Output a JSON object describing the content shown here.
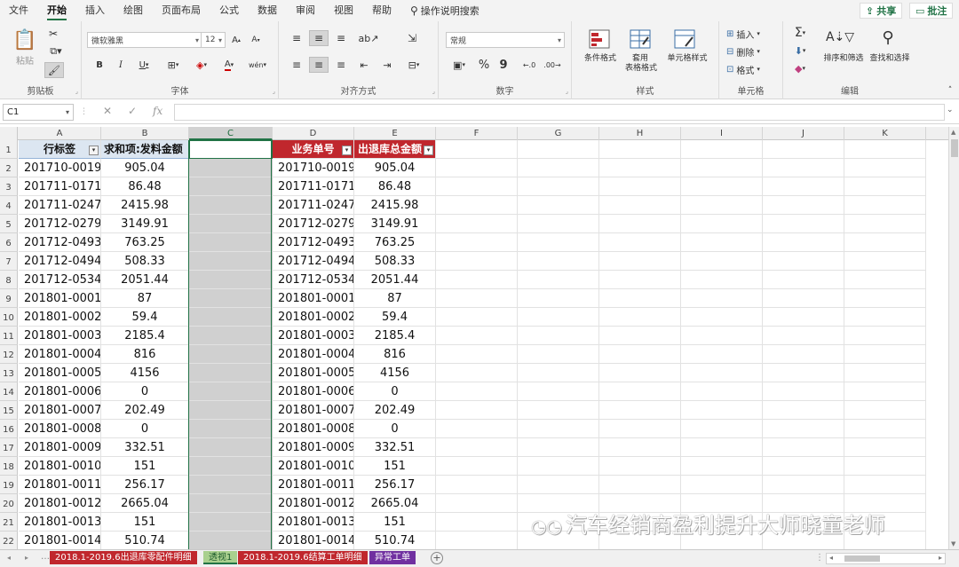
{
  "menu": {
    "items": [
      "文件",
      "开始",
      "插入",
      "绘图",
      "页面布局",
      "公式",
      "数据",
      "审阅",
      "视图",
      "帮助"
    ],
    "active_index": 1,
    "tell_me": "操作说明搜索",
    "share": "共享",
    "comments": "批注"
  },
  "ribbon": {
    "clipboard": {
      "label": "剪贴板",
      "paste": "粘贴"
    },
    "font": {
      "label": "字体",
      "name": "微软雅黑",
      "size": "12",
      "bold": "B",
      "italic": "I",
      "underline": "U",
      "grow": "A",
      "shrink": "A",
      "color": "A",
      "phonetic": "wén"
    },
    "alignment": {
      "label": "对齐方式"
    },
    "number": {
      "label": "数字",
      "format": "常规",
      "percent": "%",
      "comma": "9"
    },
    "styles": {
      "label": "样式",
      "conditional": "条件格式",
      "as_table_1": "套用",
      "as_table_2": "表格格式",
      "cell_styles": "单元格样式"
    },
    "cells": {
      "label": "单元格",
      "insert": "插入",
      "delete": "删除",
      "format": "格式"
    },
    "editing": {
      "label": "编辑",
      "sum": "Σ",
      "sort_filter": "排序和筛选",
      "find_select": "查找和选择"
    }
  },
  "formula_bar": {
    "name_box": "C1",
    "fx": "fx",
    "value": ""
  },
  "columns": [
    "A",
    "B",
    "C",
    "D",
    "E",
    "F",
    "G",
    "H",
    "I",
    "J",
    "K"
  ],
  "headers": {
    "a": "行标签",
    "b": "求和项:发料金额",
    "d": "业务单号",
    "e": "出退库总金额"
  },
  "rows": [
    {
      "n": "2",
      "a": "201710-0019",
      "b": "905.04",
      "d": "201710-0019",
      "e": "905.04"
    },
    {
      "n": "3",
      "a": "201711-0171",
      "b": "86.48",
      "d": "201711-0171",
      "e": "86.48"
    },
    {
      "n": "4",
      "a": "201711-0247",
      "b": "2415.98",
      "d": "201711-0247",
      "e": "2415.98"
    },
    {
      "n": "5",
      "a": "201712-0279",
      "b": "3149.91",
      "d": "201712-0279",
      "e": "3149.91"
    },
    {
      "n": "6",
      "a": "201712-0493",
      "b": "763.25",
      "d": "201712-0493",
      "e": "763.25"
    },
    {
      "n": "7",
      "a": "201712-0494",
      "b": "508.33",
      "d": "201712-0494",
      "e": "508.33"
    },
    {
      "n": "8",
      "a": "201712-0534",
      "b": "2051.44",
      "d": "201712-0534",
      "e": "2051.44"
    },
    {
      "n": "9",
      "a": "201801-0001",
      "b": "87",
      "d": "201801-0001",
      "e": "87"
    },
    {
      "n": "10",
      "a": "201801-0002",
      "b": "59.4",
      "d": "201801-0002",
      "e": "59.4"
    },
    {
      "n": "11",
      "a": "201801-0003",
      "b": "2185.4",
      "d": "201801-0003",
      "e": "2185.4"
    },
    {
      "n": "12",
      "a": "201801-0004",
      "b": "816",
      "d": "201801-0004",
      "e": "816"
    },
    {
      "n": "13",
      "a": "201801-0005",
      "b": "4156",
      "d": "201801-0005",
      "e": "4156"
    },
    {
      "n": "14",
      "a": "201801-0006",
      "b": "0",
      "d": "201801-0006",
      "e": "0"
    },
    {
      "n": "15",
      "a": "201801-0007",
      "b": "202.49",
      "d": "201801-0007",
      "e": "202.49"
    },
    {
      "n": "16",
      "a": "201801-0008",
      "b": "0",
      "d": "201801-0008",
      "e": "0"
    },
    {
      "n": "17",
      "a": "201801-0009",
      "b": "332.51",
      "d": "201801-0009",
      "e": "332.51"
    },
    {
      "n": "18",
      "a": "201801-0010",
      "b": "151",
      "d": "201801-0010",
      "e": "151"
    },
    {
      "n": "19",
      "a": "201801-0011",
      "b": "256.17",
      "d": "201801-0011",
      "e": "256.17"
    },
    {
      "n": "20",
      "a": "201801-0012",
      "b": "2665.04",
      "d": "201801-0012",
      "e": "2665.04"
    },
    {
      "n": "21",
      "a": "201801-0013",
      "b": "151",
      "d": "201801-0013",
      "e": "151"
    },
    {
      "n": "22",
      "a": "201801-0014",
      "b": "510.74",
      "d": "201801-0014",
      "e": "510.74"
    }
  ],
  "sheet_tabs": [
    {
      "label": "2018.1-2019.6出退库零配件明细",
      "color": "red"
    },
    {
      "label": "透视1",
      "color": "green"
    },
    {
      "label": "2018.1-2019.6结算工单明细",
      "color": "red"
    },
    {
      "label": "异常工单",
      "color": "purple"
    }
  ],
  "watermark": "汽车经销商盈利提升大师晓童老师",
  "colors": {
    "accent": "#217346",
    "header_red": "#c0272d",
    "pivot_header": "#dce6f1",
    "tab_purple": "#7030a0"
  }
}
